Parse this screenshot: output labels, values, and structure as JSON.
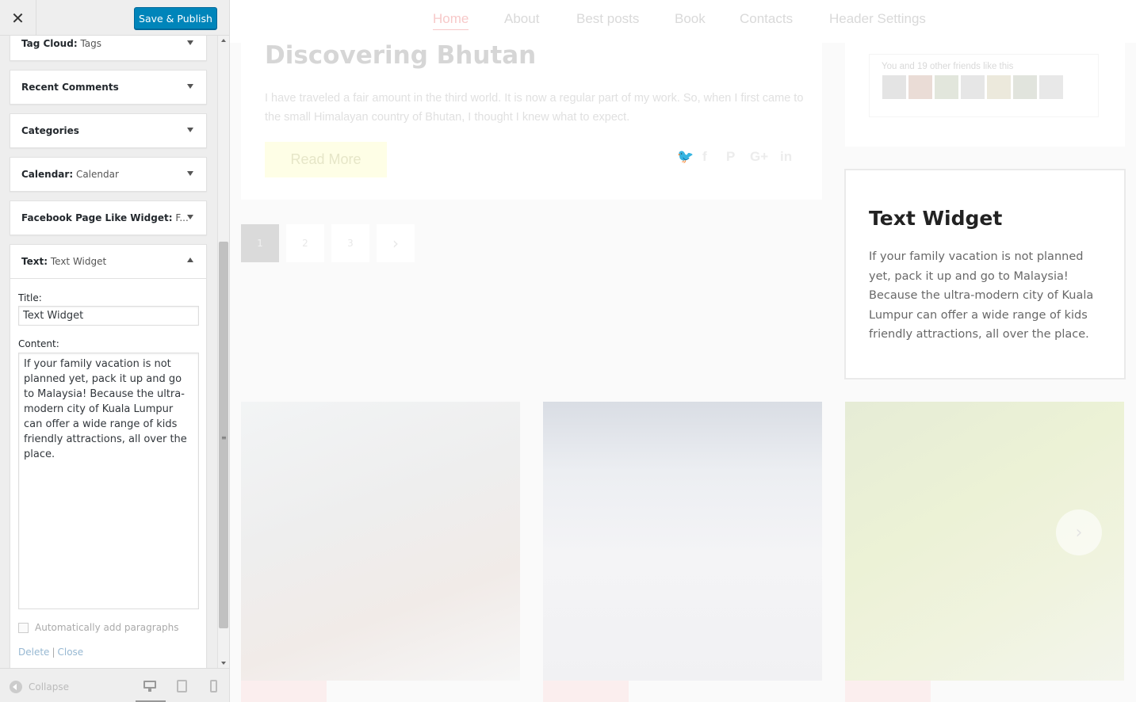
{
  "sidebar": {
    "publish_label": "Save & Publish",
    "close_glyph": "✕",
    "widgets": [
      {
        "name": "Tag Cloud",
        "subtitle": "Tags"
      },
      {
        "name": "Recent Comments",
        "subtitle": ""
      },
      {
        "name": "Categories",
        "subtitle": ""
      },
      {
        "name": "Calendar",
        "subtitle": "Calendar"
      },
      {
        "name": "Facebook Page Like Widget",
        "subtitle": "F..."
      },
      {
        "name": "Text",
        "subtitle": "Text Widget"
      }
    ],
    "text_widget": {
      "title_label": "Title:",
      "title_value": "Text Widget",
      "content_label": "Content:",
      "content_value": "If your family vacation is not planned yet, pack it up and go to Malaysia! Because the ultra-modern city of Kuala Lumpur can offer a wide range of kids friendly attractions, all over the place.",
      "autop_label": "Automatically add paragraphs",
      "delete_label": "Delete",
      "close_label": "Close"
    },
    "footer": {
      "collapse_label": "Collapse"
    }
  },
  "preview": {
    "nav": [
      "Home",
      "About",
      "Best posts",
      "Book",
      "Contacts",
      "Header Settings"
    ],
    "post": {
      "title": "Discovering Bhutan",
      "excerpt": "I have traveled a fair amount in the third world. It is now a regular part of my work. So, when I first came to the small Himalayan country of Bhutan, I thought I knew what to expect.",
      "read_more": "Read More"
    },
    "share_icons": [
      "twitter-icon",
      "facebook-icon",
      "pinterest-icon",
      "google-plus-icon",
      "linkedin-icon"
    ],
    "pagination": [
      "1",
      "2",
      "3",
      "›"
    ],
    "facebook_widget": {
      "friends_text": "You and 19 other friends like this"
    },
    "text_widget": {
      "title": "Text Widget",
      "body": "If your family vacation is not planned yet, pack it up and go to Malaysia! Because the ultra-modern city of Kuala Lumpur can of­fer a wide range of kids friendly attrac­tions, all over the place."
    },
    "slider_next_glyph": "›"
  },
  "colors": {
    "publish_button": "#0085ba",
    "sidebar_bg": "#eeeeee",
    "link": "#0073aa"
  }
}
